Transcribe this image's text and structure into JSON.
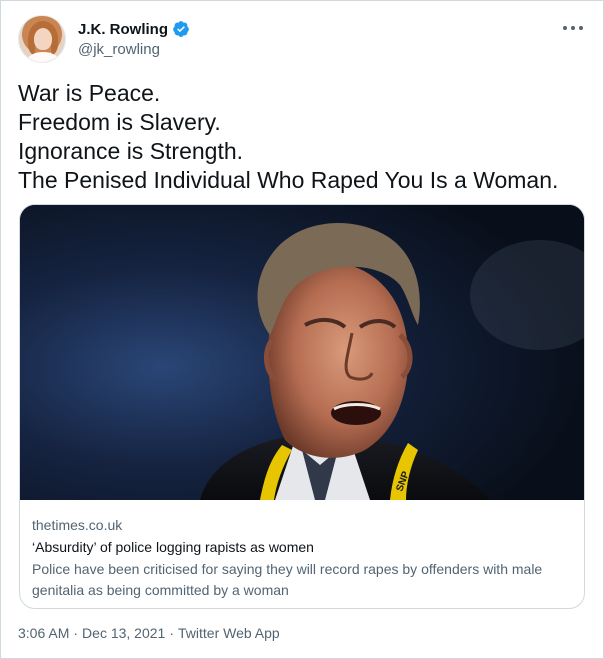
{
  "author": {
    "display_name": "J.K. Rowling",
    "handle": "@jk_rowling",
    "verified": true,
    "verified_color": "#1d9bf0"
  },
  "tweet": {
    "lines": [
      "War is Peace.",
      "Freedom is Slavery.",
      "Ignorance is Strength.",
      "The Penised Individual Who Raped You Is a Woman."
    ]
  },
  "card": {
    "domain": "thetimes.co.uk",
    "title": "‘Absurdity’ of police logging rapists as women",
    "description": "Police have been criticised for saying they will record rapes by offenders with male genitalia as being committed by a woman",
    "image_badge_text": "SNP"
  },
  "meta": {
    "time": "3:06 AM",
    "separator": "·",
    "date": "Dec 13, 2021",
    "source": "Twitter Web App"
  },
  "icons": {
    "verified": "verified-badge-icon",
    "more": "more-options-icon"
  }
}
